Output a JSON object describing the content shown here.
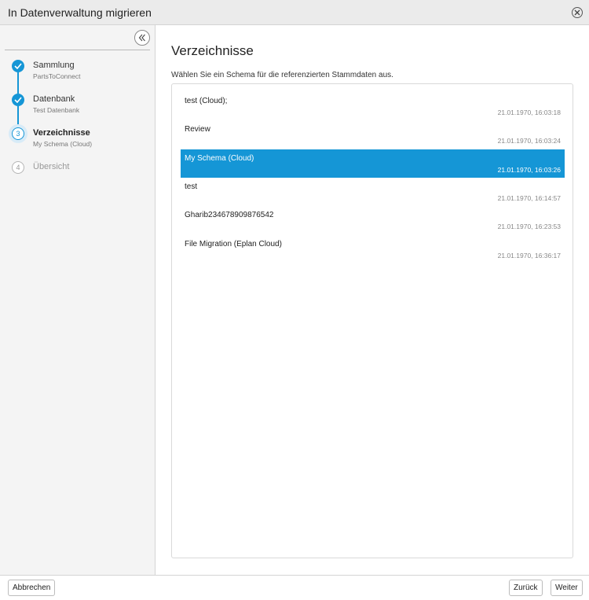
{
  "window": {
    "title": "In Datenverwaltung migrieren",
    "close_icon": "close-icon"
  },
  "sidebar": {
    "collapse_icon": "double-chevron-left-icon",
    "steps": [
      {
        "number": "1",
        "label": "Sammlung",
        "sublabel": "PartsToConnect",
        "state": "done"
      },
      {
        "number": "2",
        "label": "Datenbank",
        "sublabel": "Test Datenbank",
        "state": "done"
      },
      {
        "number": "3",
        "label": "Verzeichnisse",
        "sublabel": "My Schema (Cloud)",
        "state": "current"
      },
      {
        "number": "4",
        "label": "Übersicht",
        "sublabel": "",
        "state": "todo"
      }
    ]
  },
  "main": {
    "heading": "Verzeichnisse",
    "instruction": "Wählen Sie ein Schema für die referenzierten Stammdaten aus.",
    "items": [
      {
        "name": "test (Cloud);",
        "date": "21.01.1970, 16:03:18",
        "selected": false
      },
      {
        "name": "Review",
        "date": "21.01.1970, 16:03:24",
        "selected": false
      },
      {
        "name": "My Schema (Cloud)",
        "date": "21.01.1970, 16:03:26",
        "selected": true
      },
      {
        "name": "test",
        "date": "21.01.1970, 16:14:57",
        "selected": false
      },
      {
        "name": "Gharib234678909876542",
        "date": "21.01.1970, 16:23:53",
        "selected": false
      },
      {
        "name": "File Migration (Eplan Cloud)",
        "date": "21.01.1970, 16:36:17",
        "selected": false
      }
    ]
  },
  "footer": {
    "cancel_label": "Abbrechen",
    "back_label": "Zurück",
    "next_label": "Weiter"
  },
  "colors": {
    "accent": "#1596d6",
    "selected_text": "#ffffff",
    "titlebar_bg": "#ebebeb",
    "sidebar_bg": "#f4f4f4"
  }
}
